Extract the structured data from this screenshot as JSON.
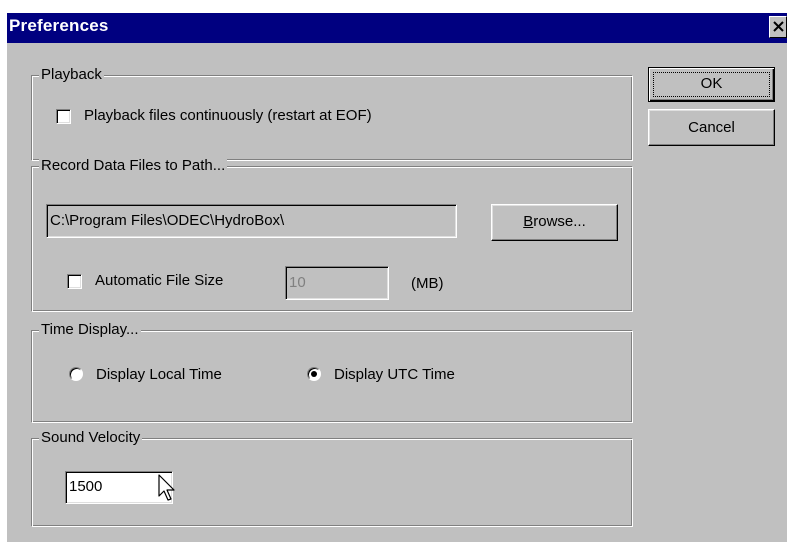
{
  "window": {
    "title": "Preferences"
  },
  "playback": {
    "group_label": "Playback",
    "continuous_label": "Playback files continuously (restart at EOF)",
    "continuous_checked": false
  },
  "record": {
    "group_label": "Record Data Files to Path...",
    "path_value": "C:\\Program Files\\ODEC\\HydroBox\\",
    "browse_label_mnemonic": "B",
    "browse_label_rest": "rowse...",
    "auto_size_label": "Automatic File Size",
    "auto_size_checked": false,
    "file_size_value": "10",
    "unit_label": "(MB)"
  },
  "time_display": {
    "group_label": "Time Display...",
    "local_label": "Display Local Time",
    "utc_label": "Display UTC Time",
    "selected": "utc"
  },
  "sound": {
    "group_label": "Sound Velocity",
    "value": "1500"
  },
  "buttons": {
    "ok": "OK",
    "cancel": "Cancel"
  },
  "colors": {
    "titlebar": "#000080",
    "face": "#c0c0c0"
  },
  "icons": {
    "close": "close-icon",
    "cursor": "mouse-pointer-icon"
  }
}
